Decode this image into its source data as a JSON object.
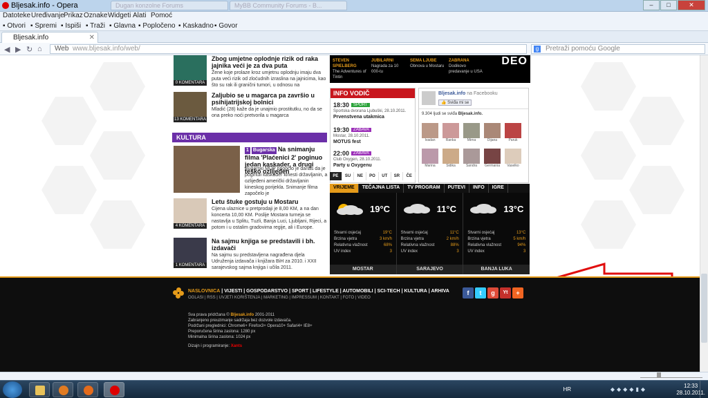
{
  "window": {
    "title": "Bljesak.info - Opera",
    "bg_tabs": [
      "Dugan konzolne Forums",
      "MyBB Community Forums - B..."
    ]
  },
  "menu": [
    "Datoteke",
    "Uređivanje",
    "Prikaz",
    "Oznake",
    "Widgeti",
    "Alati",
    "Pomoć"
  ],
  "bookmarks": [
    "Otvori",
    "Spremi",
    "Ispiši",
    "Traži",
    "Glavna",
    "Popločeno",
    "Kaskadno",
    "Govor"
  ],
  "tab": {
    "label": "Bljesak.info"
  },
  "address": {
    "prefix": "Web",
    "host": "www.bljesak.info",
    "path": "/web/",
    "search_placeholder": "Pretraži pomoću Google"
  },
  "news": [
    {
      "title": "Zbog umjetne oplodnje rizik od raka jajnika veći je za dva puta",
      "text": "Žene koje prolaze kroz umjetnu oplodnju imaju dva puta veći rizik od zloćudnih izraslina na jajnicima, kao što su rak ili granični tumori, u odnosu na",
      "count": "0 KOMENTARA"
    },
    {
      "title": "Zaljubio se u magarca pa završio u psihijatrijskoj bolnici",
      "text": "Mladić (28) kaže da je unajmio prostitutku, no da se ona preko noći pretvorila u magarca",
      "count": "13 KOMENTARA"
    },
    {
      "title": "Na snimanju filma 'Plaćenici 2' poginuo jedan kaskader, a drugi teško ozlijeđen",
      "text": "Bugarski MUP priopćio je danas da je poginuli kaskader kinesti državljanin, a ozlijeđeni američki državljanin kineskog porijekla. Snimanje filma započelo je",
      "count": "",
      "badge_num": "1",
      "badge": "Bugarska"
    },
    {
      "title": "Letu štuke gostuju u Mostaru",
      "text": "Cijena ulaznice u pretprodaji je 8,00 KM, a na dan koncerta 10,00 KM. Poslije Mostara turneja se nastavlja u Splitu, Tuzli, Banja Luci, Ljubljani, Rijeci, a potom i u ostalim gradovima regije, ali i Europe.",
      "count": "4 KOMENTARA"
    },
    {
      "title": "Na sajmu knjiga se predstavili i bh. izdavači",
      "text": "Na sajmu su predstavljena nagrađena djela Udruženja izdavača i knjižara BiH za 2010. i XXII sarajevskog sajma knjiga i učila 2011.",
      "count": "1 KOMENTARA"
    }
  ],
  "kultura": "KULTURA",
  "topmid": [
    {
      "label": "STEVEN SPIELBERG",
      "text": "The Adventures of Tintin"
    },
    {
      "label": "JUBILARNI",
      "text": "Nagrada za 10 000-tu"
    },
    {
      "label": "SEMA LJUBE",
      "text": "Obnova u Mostaru"
    },
    {
      "label": "ZABRANA",
      "text": "Dodikovo predavanje u USA"
    }
  ],
  "topmid_deo": "DEO",
  "infovodic": {
    "title": "INFO VODIČ",
    "events": [
      {
        "time": "18:30",
        "tag": "SPORT",
        "tag_color": "#2aa33a",
        "place": "Sportska dvorana Ljubuški, 28.10.2011.",
        "name": "Prvenstvena utakmica"
      },
      {
        "time": "19:30",
        "tag": "ZABAVA",
        "tag_color": "#9b2fb8",
        "place": "Mostar, 28.10.2011.",
        "name": "MOTUS fest"
      },
      {
        "time": "22:00",
        "tag": "ZABAVA",
        "tag_color": "#9b2fb8",
        "place": "Club Oxygen, 28.10.2011.",
        "name": "Party u Oxygenu"
      }
    ],
    "days": [
      "PE",
      "SU",
      "NE",
      "PO",
      "UT",
      "SR",
      "ČE"
    ]
  },
  "facebook": {
    "name": "Bljesak.info",
    "on": "na Facebooku",
    "like": "Sviđa mi se",
    "count_text": "9.304 ljudi se sviđa",
    "count_name": "Bljesak.info.",
    "fans": [
      "Ivadan",
      "Ranka",
      "Mirna",
      "Dijana",
      "Paruk",
      "Marina",
      "Sidika",
      "Sandra",
      "Germania",
      "Vaselko"
    ]
  },
  "weather": {
    "tabs": [
      "VRIJEME",
      "TEČAJNA LISTA",
      "TV PROGRAM",
      "PUTEVI",
      "INFO",
      "IGRE"
    ],
    "labels": [
      "Stvarni osjećaj",
      "Brzina vjetra",
      "Relativna vlažnost",
      "UV index"
    ],
    "cities": [
      {
        "name": "MOSTAR",
        "temp": "19°C",
        "feel": "19°C",
        "wind": "3 km/h",
        "hum": "68%",
        "uv": "3",
        "sun": true
      },
      {
        "name": "SARAJEVO",
        "temp": "11°C",
        "feel": "11°C",
        "wind": "2 km/h",
        "hum": "88%",
        "uv": "3",
        "sun": false
      },
      {
        "name": "BANJA LUKA",
        "temp": "13°C",
        "feel": "13°C",
        "wind": "5 km/h",
        "hum": "94%",
        "uv": "3",
        "sun": false
      }
    ]
  },
  "footer": {
    "nav1": [
      "NASLOVNICA",
      "VIJESTI",
      "GOSPODARSTVO",
      "SPORT",
      "LIFESTYLE",
      "AUTOMOBILI",
      "SCI-TECH",
      "KULTURA",
      "ARHIVA"
    ],
    "nav2": [
      "OGLASI",
      "RSS",
      "UVJETI KORIŠTENJA",
      "MARKETING",
      "IMPRESSUM",
      "KONTAKT",
      "FOTO",
      "VIDEO"
    ],
    "rights_a": "Sva prava pridržana ©",
    "rights_b": "Bljesak.info",
    "rights_c": "2001-2011",
    "lines": [
      "Zabranjeno preuzimanje sadržaja bez dozvole izdavača.",
      "Podržani preglednici: Chrome6+ Firefox3+ Opera10+ Safari4+ IE8+",
      "Preporučena širina zaslona: 1280 px",
      "Minimalna širina zaslona: 1024 px"
    ],
    "dev": "Dizajn i programiranje:",
    "dev_name": "Xants",
    "social": [
      {
        "letter": "f",
        "color": "#3b5998"
      },
      {
        "letter": "t",
        "color": "#35ccff"
      },
      {
        "letter": "g",
        "color": "#dd4b39"
      },
      {
        "letter": "Yt",
        "color": "#c4302b"
      },
      {
        "letter": "+",
        "color": "#f26522"
      }
    ]
  },
  "taskbar": {
    "lang": "HR",
    "time": "12:33",
    "date": "28.10.2011."
  },
  "colors": {
    "accent": "#e59b1a",
    "red": "#c8161d",
    "purple": "#6b2fa8",
    "arrow": "#e10e0e"
  }
}
